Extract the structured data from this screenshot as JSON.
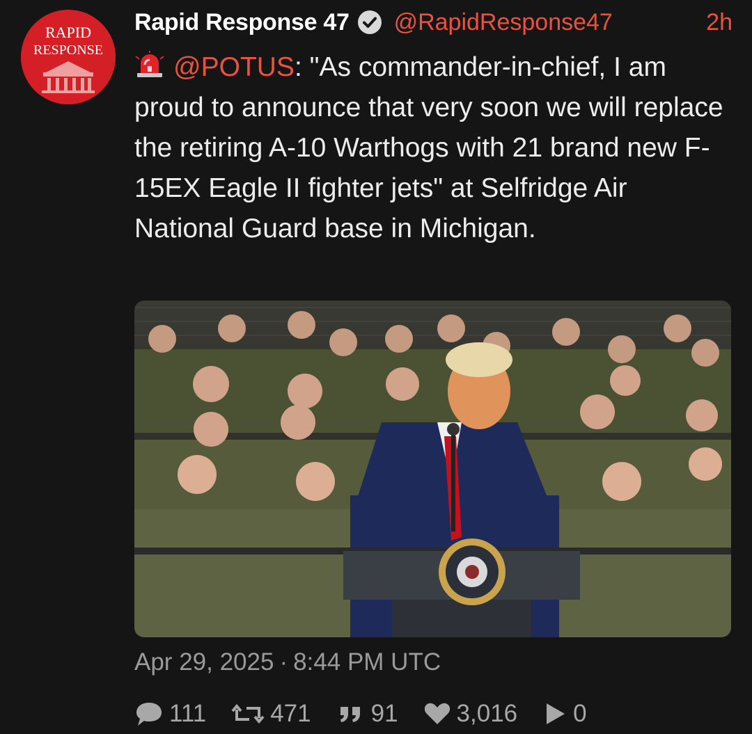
{
  "author": {
    "display_name": "Rapid Response 47",
    "handle": "@RapidResponse47",
    "relative_time": "2h",
    "avatar_text_line1": "RAPID",
    "avatar_text_line2": "RESPONSE"
  },
  "post": {
    "mention": "@POTUS",
    "text": ": \"As commander-in-chief, I am proud to announce that very soon we will replace the retiring A-10 Warthogs with 21 brand new F-15EX Eagle II fighter jets\" at Selfridge Air National Guard base in Michigan.",
    "date": "Apr 29, 2025",
    "separator": "·",
    "time": "8:44 PM UTC"
  },
  "stats": {
    "replies": "111",
    "reposts": "471",
    "quotes": "91",
    "likes": "3,016",
    "views": "0"
  },
  "icons": {
    "verified": "verified-check-icon",
    "siren": "rotating-light-icon",
    "reply": "speech-bubble-icon",
    "repost": "repost-arrows-icon",
    "quote": "quote-marks-icon",
    "like": "heart-icon",
    "views": "play-icon"
  },
  "colors": {
    "background": "#151515",
    "accent": "#e8533e",
    "avatar": "#d41f26",
    "muted": "#9a9a9a"
  }
}
